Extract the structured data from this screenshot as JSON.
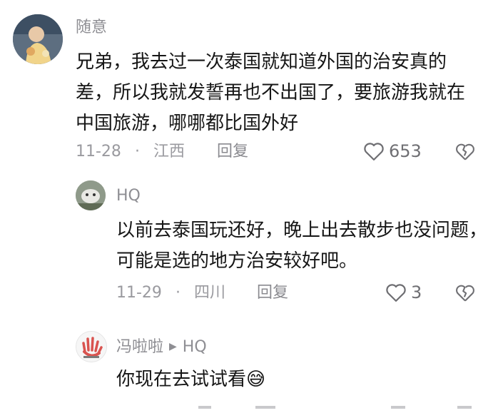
{
  "comments": [
    {
      "username": "随意",
      "text": "兄弟，我去过一次泰国就知道外国的治安真的差，所以我就发誓再也不出国了，要旅游我就在中国旅游，哪哪都比国外好",
      "date": "11-28",
      "location": "江西",
      "reply_label": "回复",
      "likes": "653"
    },
    {
      "username": "HQ",
      "text": "以前去泰国玩还好，晚上出去散步也没问题，可能是选的地方治安较好吧。",
      "date": "11-29",
      "location": "四川",
      "reply_label": "回复",
      "likes": "3"
    },
    {
      "username": "冯啦啦",
      "reply_to": "HQ",
      "text": "你现在去试试看",
      "emoji": "😅"
    }
  ],
  "meta_separator": "·",
  "icons": {
    "like": "heart-outline-icon",
    "dislike": "broken-heart-icon",
    "reply_arrow": "play-triangle-icon"
  }
}
